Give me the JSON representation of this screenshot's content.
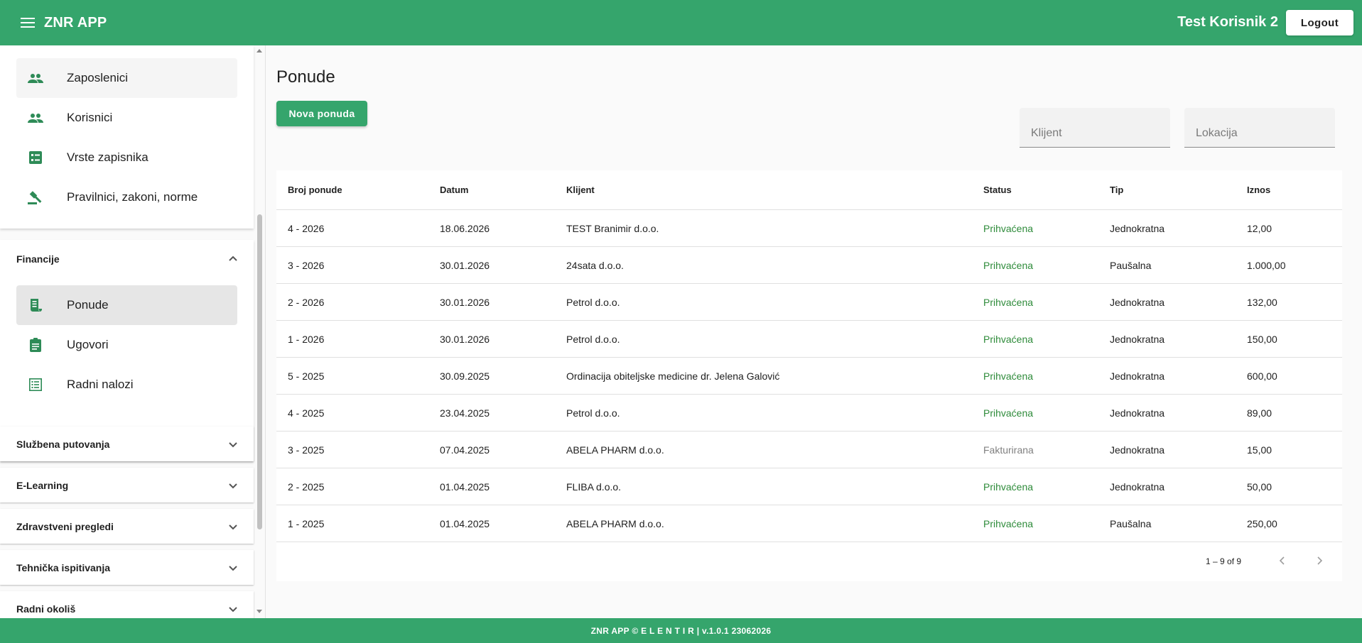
{
  "header": {
    "app_title": "ZNR APP",
    "user_name": "Test Korisnik 2",
    "logout_label": "Logout"
  },
  "sidebar": {
    "top_items": [
      {
        "label": "Zaposlenici",
        "icon": "people-icon"
      },
      {
        "label": "Korisnici",
        "icon": "people-icon"
      },
      {
        "label": "Vrste zapisnika",
        "icon": "list-alt-icon"
      },
      {
        "label": "Pravilnici, zakoni, norme",
        "icon": "gavel-icon"
      }
    ],
    "finance": {
      "label": "Financije",
      "items": [
        {
          "label": "Ponude",
          "icon": "receipt-icon",
          "active": true
        },
        {
          "label": "Ugovori",
          "icon": "assignment-icon"
        },
        {
          "label": "Radni nalozi",
          "icon": "list-icon"
        }
      ]
    },
    "sections": [
      {
        "label": "Službena putovanja"
      },
      {
        "label": "E-Learning"
      },
      {
        "label": "Zdravstveni pregledi"
      },
      {
        "label": "Tehnička ispitivanja"
      },
      {
        "label": "Radni okoliš"
      }
    ]
  },
  "main": {
    "page_title": "Ponude",
    "new_button_label": "Nova ponuda",
    "filters": {
      "client_placeholder": "Klijent",
      "location_placeholder": "Lokacija"
    },
    "table": {
      "columns": [
        "Broj ponude",
        "Datum",
        "Klijent",
        "Status",
        "Tip",
        "Iznos"
      ],
      "rows": [
        {
          "broj": "4 - 2026",
          "datum": "18.06.2026",
          "klijent": "TEST Branimir d.o.o.",
          "status": "Prihvaćena",
          "tip": "Jednokratna",
          "iznos": "12,00"
        },
        {
          "broj": "3 - 2026",
          "datum": "30.01.2026",
          "klijent": "24sata d.o.o.",
          "status": "Prihvaćena",
          "tip": "Paušalna",
          "iznos": "1.000,00"
        },
        {
          "broj": "2 - 2026",
          "datum": "30.01.2026",
          "klijent": "Petrol d.o.o.",
          "status": "Prihvaćena",
          "tip": "Jednokratna",
          "iznos": "132,00"
        },
        {
          "broj": "1 - 2026",
          "datum": "30.01.2026",
          "klijent": "Petrol d.o.o.",
          "status": "Prihvaćena",
          "tip": "Jednokratna",
          "iznos": "150,00"
        },
        {
          "broj": "5 - 2025",
          "datum": "30.09.2025",
          "klijent": "Ordinacija obiteljske medicine dr. Jelena Galović",
          "status": "Prihvaćena",
          "tip": "Jednokratna",
          "iznos": "600,00"
        },
        {
          "broj": "4 - 2025",
          "datum": "23.04.2025",
          "klijent": "Petrol d.o.o.",
          "status": "Prihvaćena",
          "tip": "Jednokratna",
          "iznos": "89,00"
        },
        {
          "broj": "3 - 2025",
          "datum": "07.04.2025",
          "klijent": "ABELA PHARM d.o.o.",
          "status": "Fakturirana",
          "tip": "Jednokratna",
          "iznos": "15,00"
        },
        {
          "broj": "2 - 2025",
          "datum": "01.04.2025",
          "klijent": "FLIBA d.o.o.",
          "status": "Prihvaćena",
          "tip": "Jednokratna",
          "iznos": "50,00"
        },
        {
          "broj": "1 - 2025",
          "datum": "01.04.2025",
          "klijent": "ABELA PHARM d.o.o.",
          "status": "Prihvaćena",
          "tip": "Paušalna",
          "iznos": "250,00"
        }
      ]
    },
    "pagination": {
      "range_text": "1 – 9 of 9"
    }
  },
  "footer": {
    "text": "ZNR APP © E L E N T I R | v.1.0.1 23062026"
  },
  "colors": {
    "brand": "#35a56c",
    "status_accepted": "#2e8b3a",
    "status_other": "#808080"
  }
}
